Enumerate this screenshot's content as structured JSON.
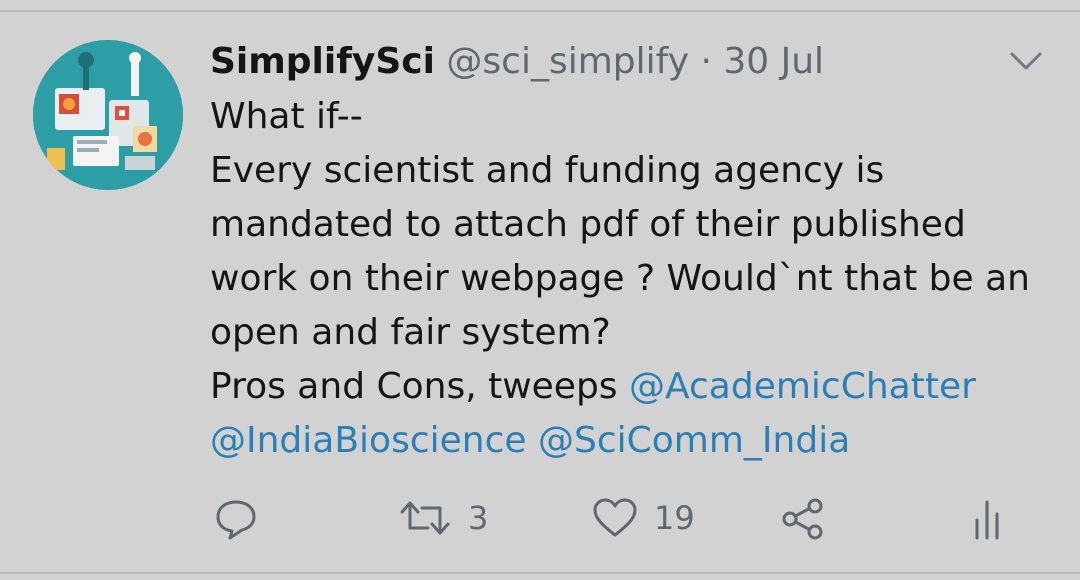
{
  "tweet": {
    "display_name": "SimplifySci",
    "handle": "@sci_simplify",
    "separator": "·",
    "date": "30 Jul",
    "text_lines": [
      "What if--",
      "Every scientist and funding agency is",
      "mandated to attach pdf of their published",
      "work on their webpage ? Would`nt that be an",
      "open and fair system?"
    ],
    "last_line_prefix": "Pros and Cons, tweeps ",
    "mentions": [
      "@AcademicChatter",
      "@IndiaBioscience",
      "@SciComm_India"
    ],
    "mention_separator": " "
  },
  "actions": {
    "reply_icon": "reply-icon",
    "retweet_icon": "retweet-icon",
    "retweet_count": "3",
    "like_icon": "heart-icon",
    "like_count": "19",
    "share_icon": "share-icon",
    "analytics_icon": "analytics-icon"
  },
  "colors": {
    "background": "#d2d2d2",
    "text": "#151515",
    "secondary": "#5d6870",
    "mention": "#2b7fb6"
  }
}
